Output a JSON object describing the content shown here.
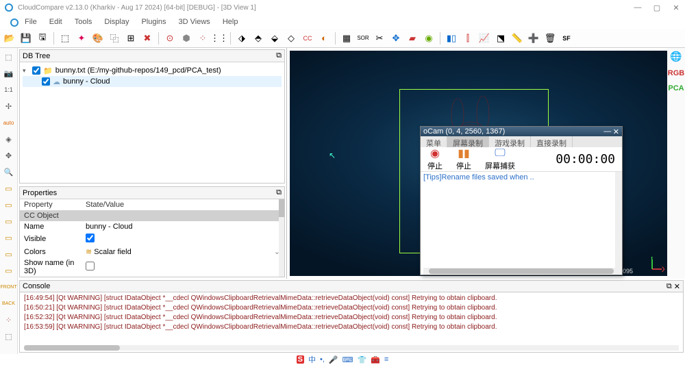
{
  "titlebar": {
    "text": "CloudCompare v2.13.0 (Kharkiv - Aug 17 2024) [64-bit] [DEBUG] - [3D View 1]"
  },
  "menu": [
    "File",
    "Edit",
    "Tools",
    "Display",
    "Plugins",
    "3D Views",
    "Help"
  ],
  "dbtree": {
    "title": "DB Tree",
    "root": {
      "label": "bunny.txt (E:/my-github-repos/149_pcd/PCA_test)",
      "checked": true
    },
    "child": {
      "label": "bunny - Cloud",
      "checked": true
    }
  },
  "props": {
    "title": "Properties",
    "header": {
      "col1": "Property",
      "col2": "State/Value"
    },
    "group": "CC Object",
    "rows": [
      {
        "k": "Name",
        "v": "bunny - Cloud"
      },
      {
        "k": "Visible",
        "v": "",
        "checkbox": true,
        "checked": true
      },
      {
        "k": "Colors",
        "v": "Scalar field",
        "dropdown": true
      },
      {
        "k": "Show name (in 3D)",
        "v": "",
        "checkbox": true,
        "checked": false
      }
    ]
  },
  "viewport": {
    "scale": "0. 095"
  },
  "ocam": {
    "title": "oCam (0, 4, 2560, 1367)",
    "tabs": [
      "菜单",
      "屏幕录制",
      "游戏录制",
      "直接录制"
    ],
    "active_tab": 1,
    "buttons": [
      {
        "name": "stop",
        "label": "停止",
        "color": "#d03030",
        "glyph": "◉"
      },
      {
        "name": "pause",
        "label": "停止",
        "color": "#e08030",
        "glyph": "▮▮"
      },
      {
        "name": "capture",
        "label": "屏幕捕获",
        "color": "#3a6fd0",
        "glyph": "🖵"
      }
    ],
    "time": "00:00:00",
    "tip_prefix": "[Tips]",
    "tip": "Rename files saved when .."
  },
  "console": {
    "title": "Console",
    "lines": [
      "[16:49:54] [Qt WARNING] [struct IDataObject *__cdecl QWindowsClipboardRetrievalMimeData::retrieveDataObject(void) const] Retrying to obtain clipboard.",
      "[16:50:21] [Qt WARNING] [struct IDataObject *__cdecl QWindowsClipboardRetrievalMimeData::retrieveDataObject(void) const] Retrying to obtain clipboard.",
      "[16:52:32] [Qt WARNING] [struct IDataObject *__cdecl QWindowsClipboardRetrievalMimeData::retrieveDataObject(void) const] Retrying to obtain clipboard.",
      "[16:53:59] [Qt WARNING] [struct IDataObject *__cdecl QWindowsClipboardRetrievalMimeData::retrieveDataObject(void) const] Retrying to obtain clipboard."
    ]
  },
  "rightbar_labels": [
    "RGB",
    "PCA"
  ]
}
